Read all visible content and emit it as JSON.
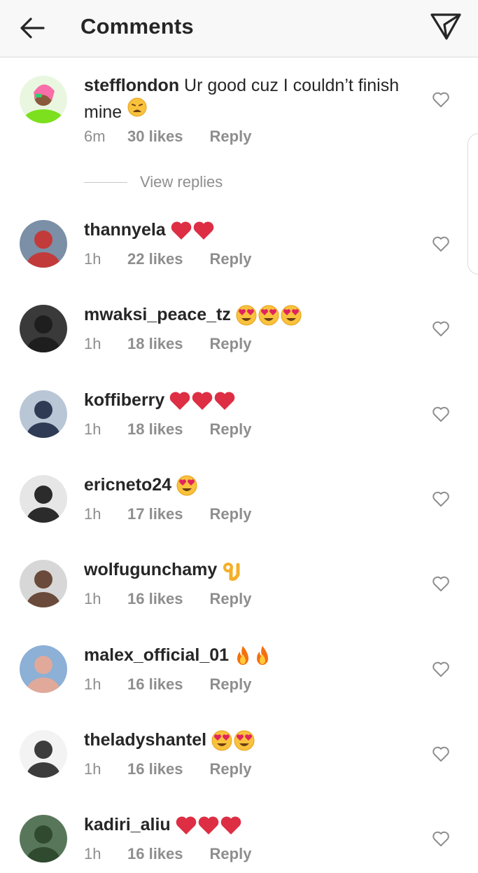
{
  "header": {
    "title": "Comments"
  },
  "first_comment": {
    "username": "stefflondon",
    "text": " Ur good cuz I couldn’t finish mine",
    "emojis": [
      "weary"
    ],
    "time": "6m",
    "likes": "30 likes",
    "reply": "Reply"
  },
  "view_replies": "View replies",
  "comments": [
    {
      "username": "thannyela",
      "emojis": [
        "heart",
        "heart"
      ],
      "time": "1h",
      "likes": "22 likes",
      "reply": "Reply"
    },
    {
      "username": "mwaksi_peace_tz",
      "emojis": [
        "heart-eyes",
        "heart-eyes",
        "heart-eyes"
      ],
      "time": "1h",
      "likes": "18 likes",
      "reply": "Reply"
    },
    {
      "username": "koffiberry",
      "emojis": [
        "heart",
        "heart",
        "heart"
      ],
      "time": "1h",
      "likes": "18 likes",
      "reply": "Reply"
    },
    {
      "username": "ericneto24",
      "emojis": [
        "heart-eyes"
      ],
      "time": "1h",
      "likes": "17 likes",
      "reply": "Reply"
    },
    {
      "username": "wolfugunchamy",
      "emojis": [
        "ok-hand"
      ],
      "time": "1h",
      "likes": "16 likes",
      "reply": "Reply"
    },
    {
      "username": "malex_official_01",
      "emojis": [
        "fire",
        "fire"
      ],
      "time": "1h",
      "likes": "16 likes",
      "reply": "Reply"
    },
    {
      "username": "theladyshantel",
      "emojis": [
        "heart-eyes",
        "heart-eyes"
      ],
      "time": "1h",
      "likes": "16 likes",
      "reply": "Reply"
    },
    {
      "username": "kadiri_aliu",
      "emojis": [
        "heart",
        "heart",
        "heart"
      ],
      "time": "1h",
      "likes": "16 likes",
      "reply": "Reply"
    }
  ],
  "colors": {
    "text": "#262626",
    "muted": "#8e8e8e",
    "header_bg": "#f8f8f8",
    "heart_red": "#e0245e"
  }
}
